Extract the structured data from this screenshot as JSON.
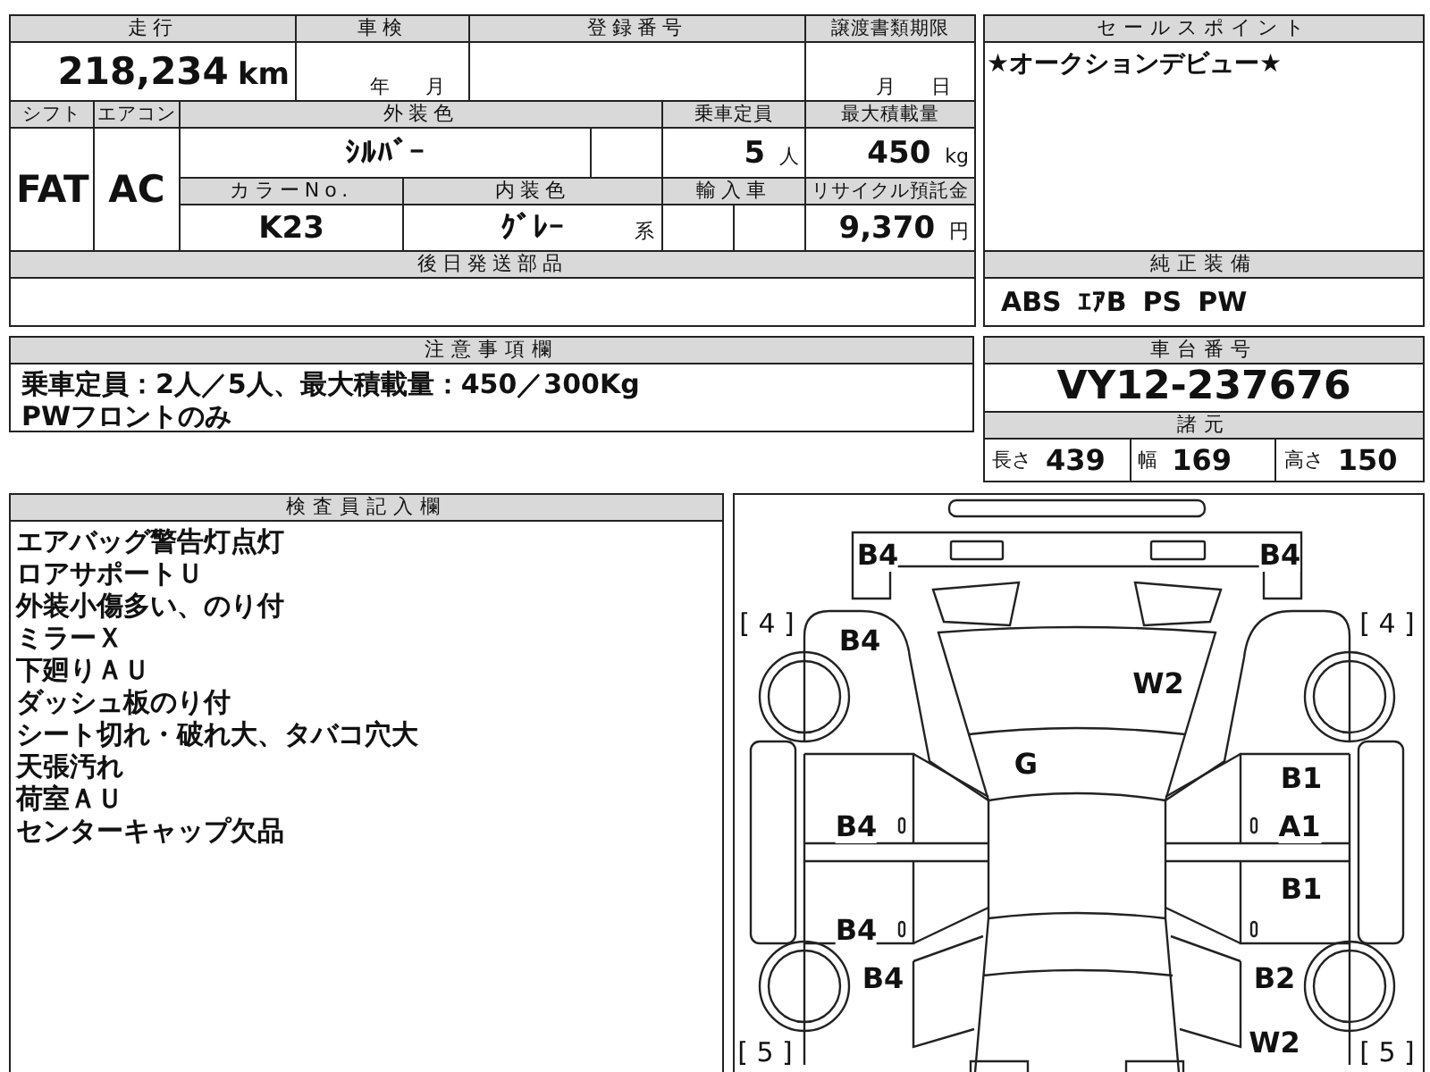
{
  "vehicle_table": {
    "mileage": {
      "label": "走行",
      "value": "218,234",
      "unit": "km"
    },
    "inspection": {
      "label": "車検",
      "year_unit": "年",
      "month_unit": "月"
    },
    "registration_number": {
      "label": "登録番号"
    },
    "transfer_deadline": {
      "label": "譲渡書類期限",
      "month_unit": "月",
      "day_unit": "日"
    },
    "shift": {
      "label": "シフト",
      "value": "FAT"
    },
    "aircon": {
      "label": "エアコン",
      "value": "AC"
    },
    "exterior_color": {
      "label": "外装色",
      "value": "ｼﾙﾊﾞｰ"
    },
    "capacity": {
      "label": "乗車定員",
      "value": "5",
      "unit": "人"
    },
    "max_load": {
      "label": "最大積載量",
      "value": "450",
      "unit": "kg"
    },
    "color_no": {
      "label": "カラーNo.",
      "value": "K23"
    },
    "interior_color": {
      "label": "内装色",
      "value": "ｸﾞﾚｰ",
      "suffix": "系"
    },
    "imported": {
      "label": "輸入車"
    },
    "recycle_fee": {
      "label": "リサイクル預託金",
      "value": "9,370",
      "unit": "円"
    },
    "later_parts": {
      "label": "後日発送部品"
    }
  },
  "sale_points": {
    "label": "セールスポイント",
    "text": "★オークションデビュー★"
  },
  "standard_equipment": {
    "label": "純正装備",
    "items": [
      "ABS",
      "ｴｱB",
      "PS",
      "PW"
    ]
  },
  "notes": {
    "label": "注意事項欄",
    "lines": [
      "乗車定員：2人／5人、最大積載量：450／300Kg",
      "PWフロントのみ"
    ]
  },
  "chassis": {
    "label": "車台番号",
    "value": "VY12-237676"
  },
  "specs": {
    "label": "諸元",
    "items": [
      {
        "label": "長さ",
        "value": "439"
      },
      {
        "label": "幅",
        "value": "169"
      },
      {
        "label": "高さ",
        "value": "150"
      }
    ]
  },
  "inspector_remarks": {
    "label": "検査員記入欄",
    "lines": [
      "エアバッグ警告灯点灯",
      "ロアサポートＵ",
      "外装小傷多い、のり付",
      "ミラーＸ",
      "下廻りＡＵ",
      "ダッシュ板のり付",
      "シート切れ・破れ大、タバコ穴大",
      "天張汚れ",
      "荷室ＡＵ",
      "センターキャップ欠品"
    ]
  },
  "damage_map": {
    "tires": [
      "[ 4 ]",
      "[ 4 ]",
      "[ 5 ]",
      "[ 5 ]"
    ],
    "marks": [
      "B4",
      "B4",
      "B4",
      "W2",
      "G",
      "B1",
      "B4",
      "A1",
      "B1",
      "B4",
      "B4",
      "B2",
      "W2"
    ]
  }
}
